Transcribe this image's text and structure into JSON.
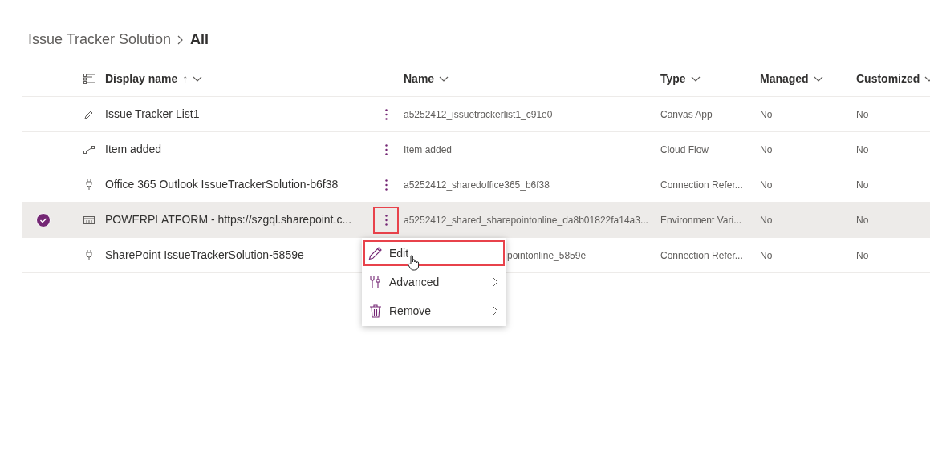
{
  "breadcrumb": [
    {
      "label": "Issue Tracker Solution",
      "current": false
    },
    {
      "label": "All",
      "current": true
    }
  ],
  "table": {
    "columns": [
      {
        "label": "Display name",
        "sort_arrow": "↑"
      },
      {
        "label": "Name"
      },
      {
        "label": "Type"
      },
      {
        "label": "Managed"
      },
      {
        "label": "Customized"
      }
    ],
    "rows": [
      {
        "kind": "canvas",
        "selected": false,
        "display_name": "Issue Tracker List1",
        "more_highlighted": false,
        "name": "a5252412_issuetrackerlist1_c91e0",
        "type": "Canvas App",
        "managed": "No",
        "customized": "No"
      },
      {
        "kind": "flow",
        "selected": false,
        "display_name": "Item added",
        "more_highlighted": false,
        "name": "Item added",
        "type": "Cloud Flow",
        "managed": "No",
        "customized": "No"
      },
      {
        "kind": "connection",
        "selected": false,
        "display_name": "Office 365 Outlook IssueTrackerSolution-b6f38",
        "more_highlighted": false,
        "name": "a5252412_sharedoffice365_b6f38",
        "type": "Connection Refer...",
        "managed": "No",
        "customized": "No"
      },
      {
        "kind": "variable",
        "selected": true,
        "display_name": "POWERPLATFORM - https://szgql.sharepoint.c...",
        "more_highlighted": true,
        "name": "a5252412_shared_sharepointonline_da8b01822fa14a3...",
        "type": "Environment Vari...",
        "managed": "No",
        "customized": "No"
      },
      {
        "kind": "connection",
        "selected": false,
        "display_name": "SharePoint IssueTrackerSolution-5859e",
        "name": "pointonline_5859e",
        "type": "Connection Refer...",
        "managed": "No",
        "customized": "No"
      }
    ]
  },
  "context_menu": {
    "items": [
      {
        "kind": "edit",
        "label": "Edit",
        "highlighted": true,
        "submenu": false
      },
      {
        "kind": "advanced",
        "label": "Advanced",
        "highlighted": false,
        "submenu": true
      },
      {
        "kind": "remove",
        "label": "Remove",
        "highlighted": false,
        "submenu": true
      }
    ]
  }
}
